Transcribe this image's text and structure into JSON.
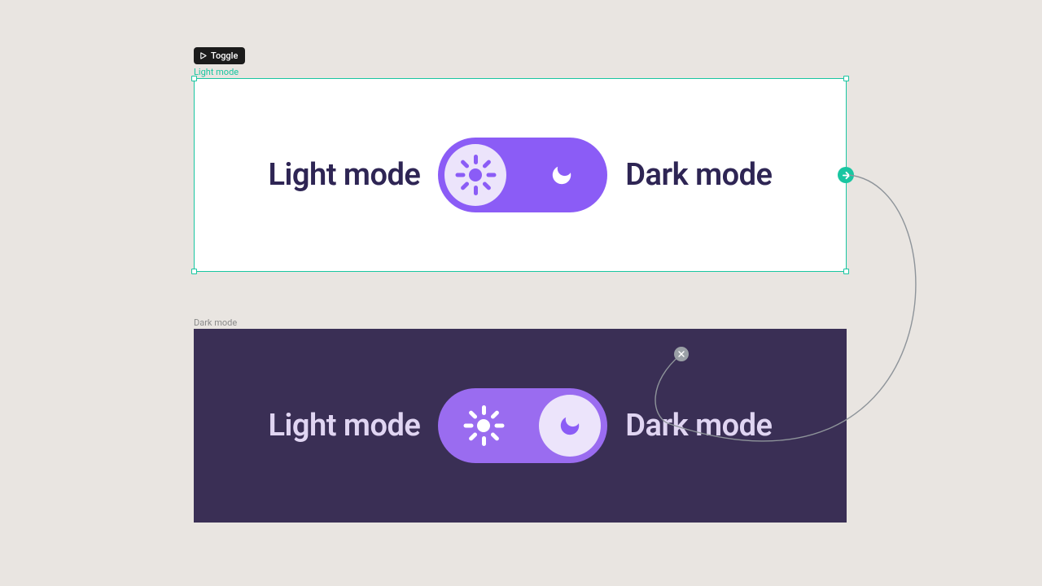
{
  "badge": {
    "label": "Toggle"
  },
  "frames": {
    "light": {
      "name": "Light mode",
      "left_label": "Light mode",
      "right_label": "Dark mode"
    },
    "dark": {
      "name": "Dark mode",
      "left_label": "Light mode",
      "right_label": "Dark mode"
    }
  },
  "colors": {
    "selection": "#19c6a1",
    "toggle_light": "#8b5cf6",
    "toggle_dark": "#9a6cf0",
    "knob": "#ece4fb",
    "dark_bg": "#3a2f55",
    "text_light": "#2e2554",
    "text_dark": "#e0d5f2"
  }
}
